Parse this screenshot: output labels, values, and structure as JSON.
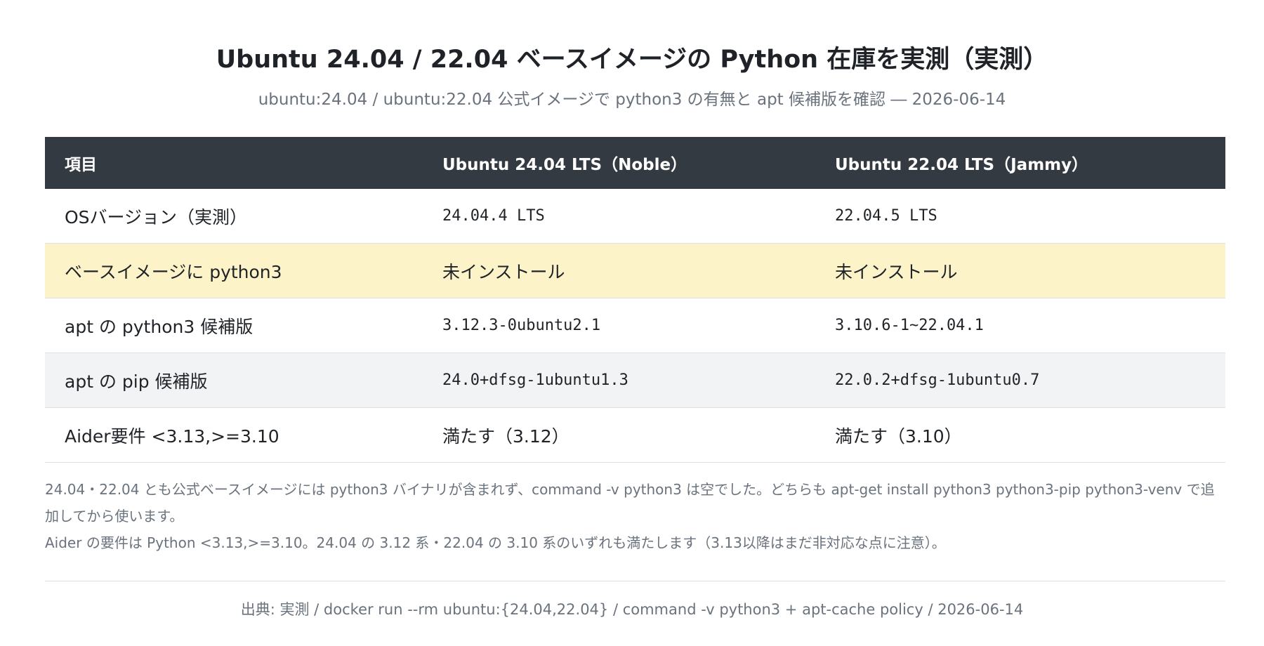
{
  "header": {
    "title": "Ubuntu 24.04 / 22.04 ベースイメージの Python 在庫を実測（実測）",
    "subtitle": "ubuntu:24.04 / ubuntu:22.04 公式イメージで python3 の有無と apt 候補版を確認 ― 2026-06-14"
  },
  "table": {
    "columns": [
      "項目",
      "Ubuntu 24.04 LTS（Noble）",
      "Ubuntu 22.04 LTS（Jammy）"
    ],
    "rows": [
      {
        "item": "OSバージョン（実測）",
        "noble": "24.04.4 LTS",
        "jammy": "22.04.5 LTS"
      },
      {
        "item": "ベースイメージに python3",
        "noble": "未インストール",
        "jammy": "未インストール"
      },
      {
        "item": "apt の python3 候補版",
        "noble": "3.12.3-0ubuntu2.1",
        "jammy": "3.10.6-1~22.04.1"
      },
      {
        "item": "apt の pip 候補版",
        "noble": "24.0+dfsg-1ubuntu1.3",
        "jammy": "22.0.2+dfsg-1ubuntu0.7"
      },
      {
        "item": "Aider要件 <3.13,>=3.10",
        "noble": "満たす（3.12）",
        "jammy": "満たす（3.10）"
      }
    ]
  },
  "notes": [
    "24.04・22.04 とも公式ベースイメージには python3 バイナリが含まれず、command -v python3 は空でした。どちらも apt-get install python3 python3-pip python3-venv で追加してから使います。",
    "Aider の要件は Python <3.13,>=3.10。24.04 の 3.12 系・22.04 の 3.10 系のいずれも満たします（3.13以降はまだ非対応な点に注意）。"
  ],
  "source": "出典: 実測 / docker run --rm ubuntu:{24.04,22.04} / command -v python3 + apt-cache policy / 2026-06-14",
  "colors": {
    "header_bg": "#343a41",
    "highlight_row": "#fdf3c8",
    "shaded_row": "#f2f3f5"
  }
}
